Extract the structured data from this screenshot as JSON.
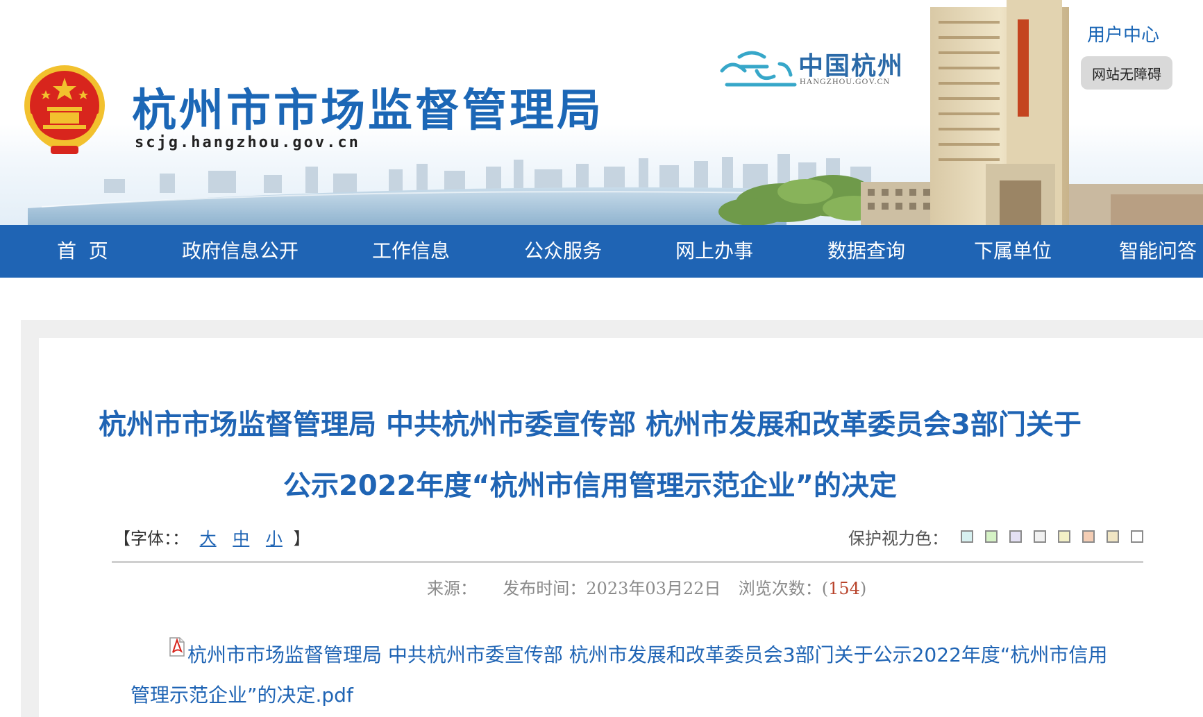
{
  "header": {
    "title": "杭州市市场监督管理局",
    "domain": "scjg.hangzhou.gov.cn",
    "partner_logo": {
      "name": "中国杭州",
      "domain": "HANGZHOU.GOV.CN"
    },
    "user_center": "用户中心",
    "accessibility": "网站无障碍"
  },
  "nav": {
    "items": [
      {
        "label": "首  页"
      },
      {
        "label": "政府信息公开"
      },
      {
        "label": "工作信息"
      },
      {
        "label": "公众服务"
      },
      {
        "label": "网上办事"
      },
      {
        "label": "数据查询"
      },
      {
        "label": "下属单位"
      },
      {
        "label": "智能问答"
      }
    ]
  },
  "article": {
    "title": "杭州市市场监督管理局 中共杭州市委宣传部 杭州市发展和改革委员会3部门关于公示2022年度“杭州市信用管理示范企业”的决定",
    "font_size": {
      "prefix": "【字体：：",
      "large": "大",
      "medium": "中",
      "small": "小",
      "suffix": "】"
    },
    "eye_care": {
      "label": "保护视力色：",
      "colors": [
        "#d7f0f0",
        "#d5f2c5",
        "#e4e0f4",
        "#f1f1f1",
        "#f3f0c6",
        "#f4cdb4",
        "#f1e6c4",
        "#ffffff"
      ]
    },
    "meta": {
      "source_label": "来源：",
      "publish_label": "发布时间：",
      "publish_date": "2023年03月22日",
      "views_label": "浏览次数：",
      "views_open": "(",
      "views_count": "154",
      "views_close": ")"
    },
    "attachment": {
      "icon": "pdf-icon",
      "text": "杭州市市场监督管理局 中共杭州市委宣传部 杭州市发展和改革委员会3部门关于公示2022年度“杭州市信用管理示范企业”的决定.pdf"
    }
  },
  "colors": {
    "brand_blue": "#1f64b4",
    "nav_bg": "#1f64b4",
    "emblem_red": "#d8251d",
    "emblem_gold": "#f2c12e"
  }
}
